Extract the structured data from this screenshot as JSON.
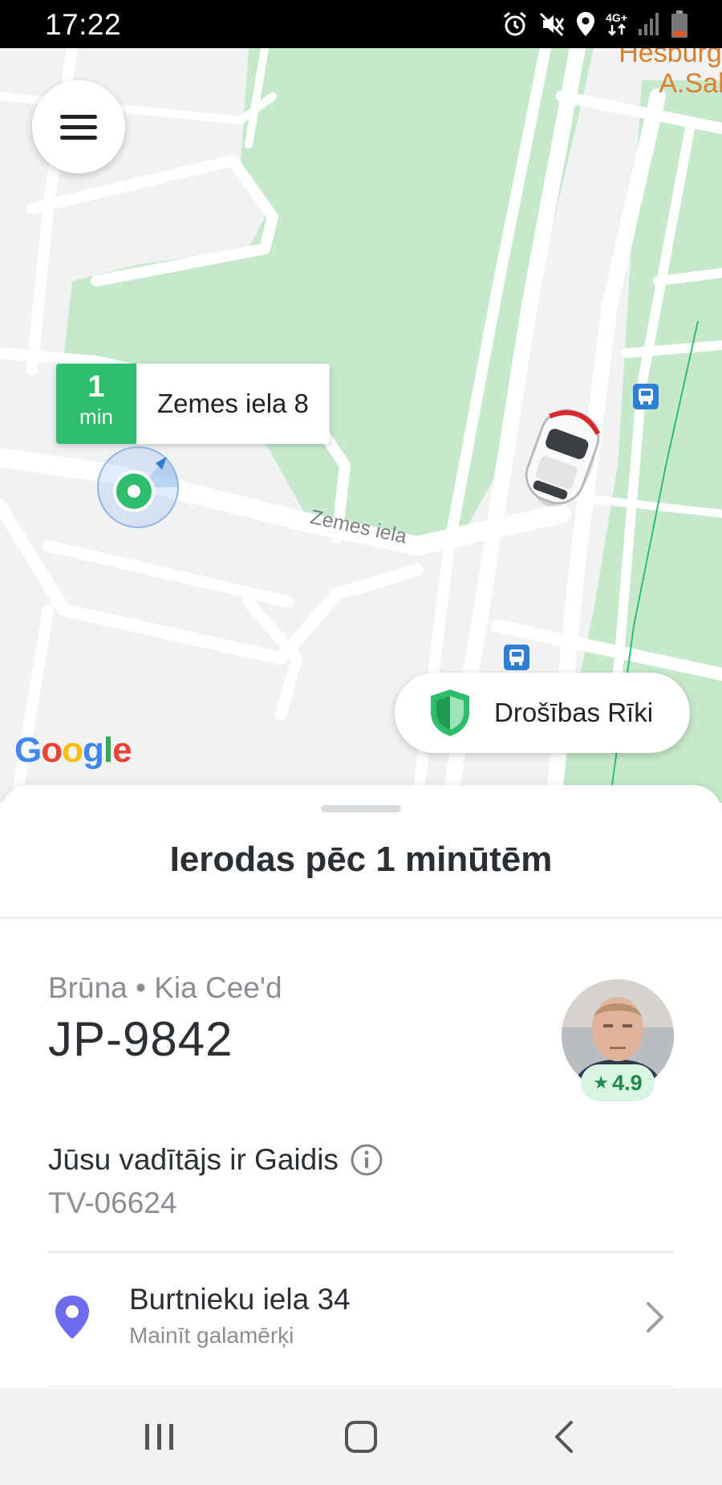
{
  "status_bar": {
    "time": "17:22",
    "network": "4G+",
    "icons": [
      "alarm-icon",
      "mute-icon",
      "location-icon",
      "network-4g-icon",
      "signal-icon",
      "battery-icon"
    ]
  },
  "map": {
    "poi_labels": [
      "Hesburger",
      "A.Sah"
    ],
    "street_label": "Zemes iela",
    "pickup": {
      "eta_number": "1",
      "eta_unit": "min",
      "address": "Zemes iela 8"
    },
    "google_logo": "Google",
    "safety_button_label": "Drošības Rīki"
  },
  "sheet": {
    "title": "Ierodas pēc 1 minūtēm",
    "car_description": "Brūna • Kia Cee'd",
    "plate": "JP-9842",
    "driver_rating": "4.9",
    "driver_text": "Jūsu vadītājs ir Gaidis",
    "license_number": "TV-06624",
    "destination": {
      "title": "Burtnieku iela 34",
      "subtitle": "Mainīt galamērķi"
    }
  },
  "colors": {
    "accent_green": "#2ebd6c",
    "park_green": "#c7e9cb",
    "pin_purple": "#6f6bf0",
    "poi_orange": "#d9802f",
    "bus_blue": "#2f7fd6"
  },
  "nav_bar": [
    "recents-icon",
    "home-icon",
    "back-icon"
  ]
}
